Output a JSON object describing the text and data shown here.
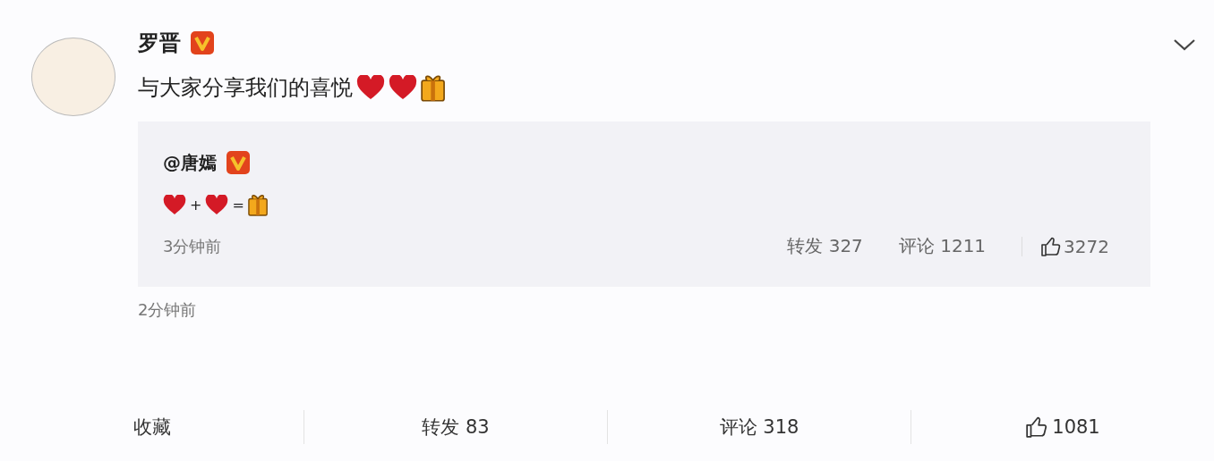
{
  "post": {
    "author": "罗晋",
    "verified": true,
    "content": [
      {
        "kind": "text",
        "text": "与大家分享我们的喜悦"
      },
      {
        "kind": "heart"
      },
      {
        "kind": "heart"
      },
      {
        "kind": "gift"
      }
    ],
    "repost": {
      "author": "@唐嫣",
      "verified": true,
      "content": [
        {
          "kind": "heart"
        },
        {
          "kind": "text",
          "text": "+"
        },
        {
          "kind": "heart"
        },
        {
          "kind": "text",
          "text": "="
        },
        {
          "kind": "gift"
        }
      ],
      "time": "3分钟前",
      "stats": [
        {
          "kind": "repost",
          "label": "转发 327"
        },
        {
          "kind": "comment",
          "label": "评论 1211"
        },
        {
          "kind": "like",
          "label": "3272"
        }
      ]
    },
    "time": "2分钟前"
  },
  "actions": [
    {
      "kind": "favorite",
      "label": "收藏"
    },
    {
      "kind": "repost",
      "label": "转发 83"
    },
    {
      "kind": "comment",
      "label": "评论 318"
    },
    {
      "kind": "like",
      "label": "1081"
    }
  ]
}
